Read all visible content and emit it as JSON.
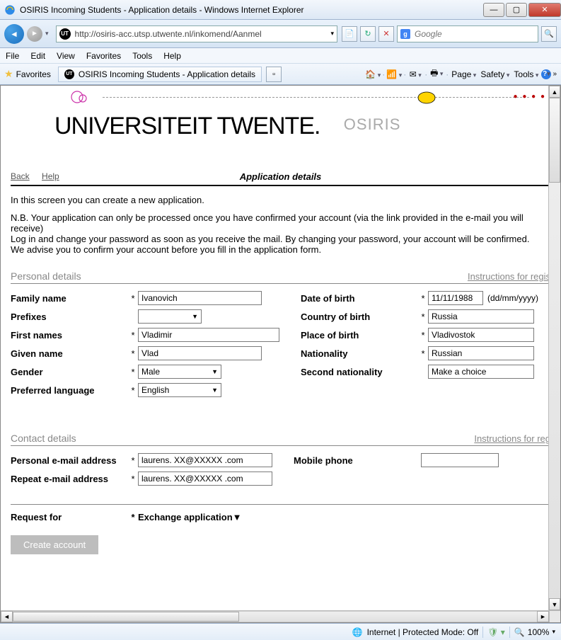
{
  "window": {
    "title": "OSIRIS Incoming Students - Application details - Windows Internet Explorer"
  },
  "nav": {
    "url": "http://osiris-acc.utsp.utwente.nl/inkomend/Aanmel",
    "search_placeholder": "Google"
  },
  "menubar": [
    "File",
    "Edit",
    "View",
    "Favorites",
    "Tools",
    "Help"
  ],
  "cmdbar": {
    "favorites": "Favorites",
    "tab_title": "OSIRIS Incoming Students - Application details",
    "page": "Page",
    "safety": "Safety",
    "tools": "Tools"
  },
  "page": {
    "brand": "UNIVERSITEIT TWENTE.",
    "osiris": "OSIRIS",
    "back": "Back",
    "help": "Help",
    "app_title": "Application details",
    "intro": "In this screen you can create a new application.",
    "note1": "N.B. Your application can only be processed once you have confirmed your account (via the link provided in the e-mail you will receive)",
    "note2": "Log in and change your password as soon as you receive the mail. By changing your password, your account will be confirmed.",
    "note3": "We advise you to confirm your account before you fill in the application form.",
    "sections": {
      "personal": "Personal details",
      "contact": "Contact details",
      "instr1": "Instructions for regis",
      "instr2": "Instructions for reg"
    },
    "labels": {
      "family": "Family name",
      "prefixes": "Prefixes",
      "first": "First names",
      "given": "Given name",
      "gender": "Gender",
      "lang": "Preferred language",
      "dob": "Date of birth",
      "dob_hint": "(dd/mm/yyyy)",
      "cob": "Country of birth",
      "pob": "Place of birth",
      "nat": "Nationality",
      "nat2": "Second nationality",
      "email": "Personal e-mail address",
      "email2": "Repeat e-mail address",
      "mobile": "Mobile phone",
      "request": "Request for"
    },
    "values": {
      "family": "Ivanovich",
      "first": "Vladimir",
      "given": "Vlad",
      "gender": "Male",
      "lang": "English",
      "dob": "11/11/1988",
      "cob": "Russia",
      "pob": "Vladivostok",
      "nat": "Russian",
      "nat2": "Make a choice",
      "email": "laurens. XX@XXXXX .com",
      "email2": "laurens. XX@XXXXX .com",
      "request": "Exchange application"
    },
    "create": "Create account"
  },
  "status": {
    "zone": "Internet | Protected Mode: Off",
    "zoom": "100%"
  }
}
